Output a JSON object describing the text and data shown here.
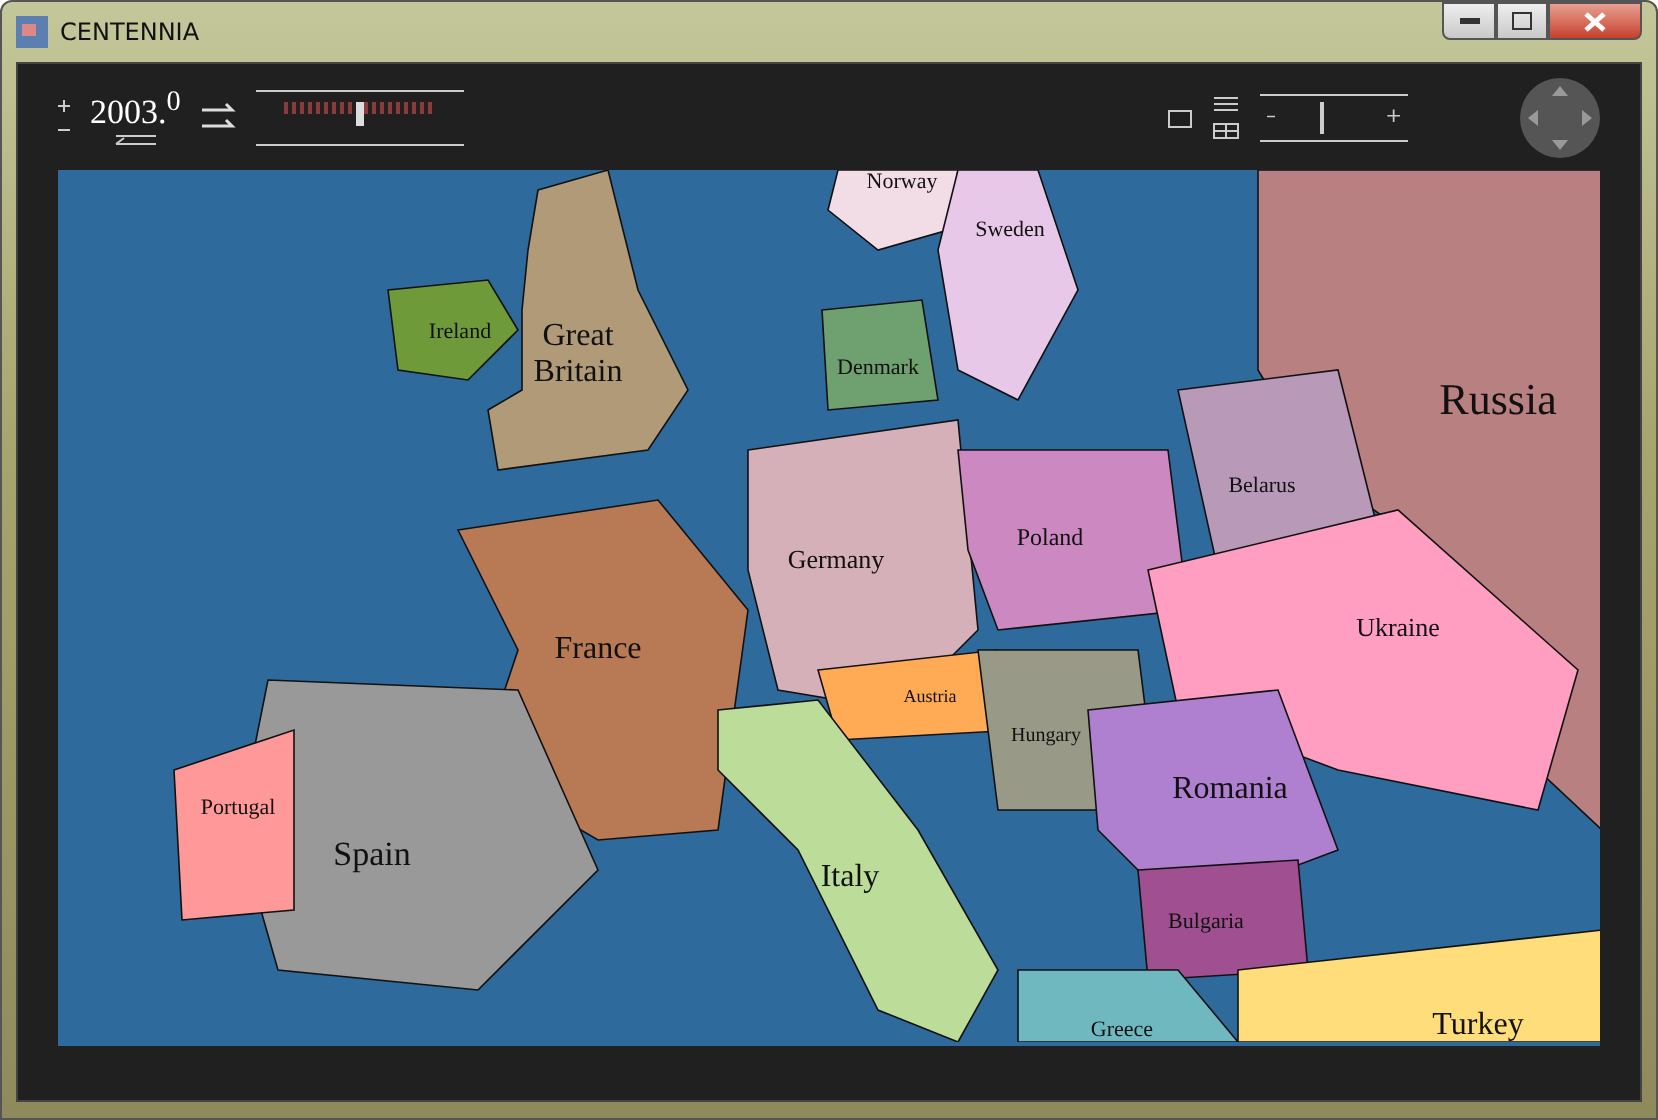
{
  "window": {
    "title": "CENTENNIA"
  },
  "toolbar": {
    "year": "2003.$^{0}$",
    "timeline": {
      "level": 0.5
    },
    "zoom": {
      "minus": "–",
      "plus": "+",
      "level": 0.4
    }
  },
  "map": {
    "labels": [
      {
        "name": "Norway"
      },
      {
        "name": "Sweden"
      },
      {
        "name": "Ireland"
      },
      {
        "name": "Great Britain"
      },
      {
        "name": "Denmark"
      },
      {
        "name": "Russia"
      },
      {
        "name": "Belarus"
      },
      {
        "name": "Poland"
      },
      {
        "name": "Germany"
      },
      {
        "name": "Ukraine"
      },
      {
        "name": "France"
      },
      {
        "name": "Austria"
      },
      {
        "name": "Hungary"
      },
      {
        "name": "Romania"
      },
      {
        "name": "Portugal"
      },
      {
        "name": "Spain"
      },
      {
        "name": "Italy"
      },
      {
        "name": "Bulgaria"
      },
      {
        "name": "Greece"
      },
      {
        "name": "Turkey"
      }
    ]
  }
}
